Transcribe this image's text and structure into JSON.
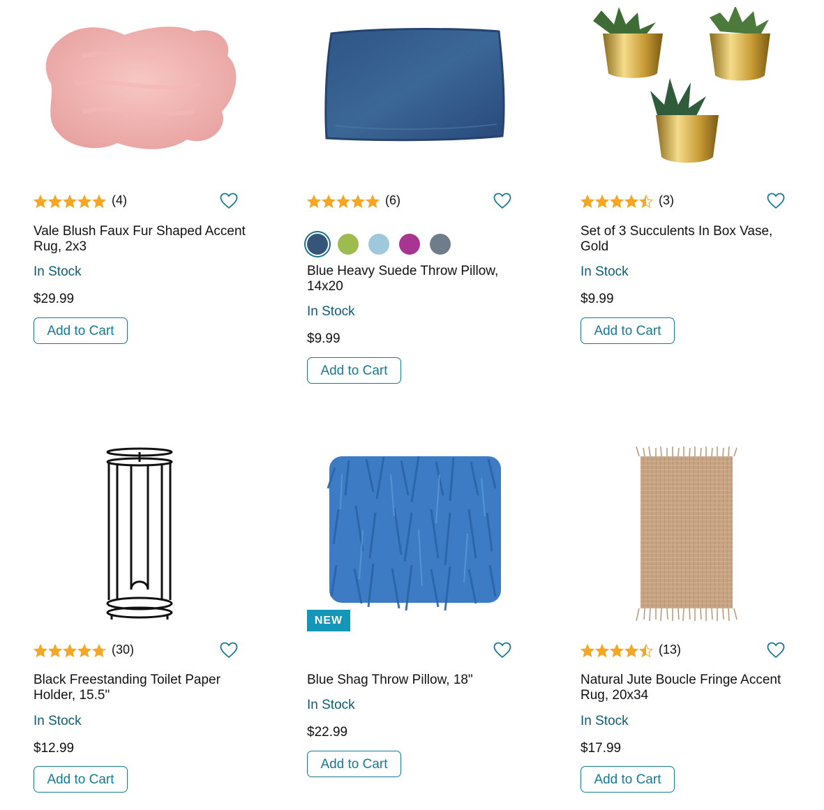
{
  "colors": {
    "accent": "#167993",
    "stock": "#0d5c7a",
    "star_fill": "#f5a623",
    "badge": "#1496b8"
  },
  "products": [
    {
      "name": "Vale Blush Faux Fur Shaped Accent Rug, 2x3",
      "rating": 5,
      "review_count": "(4)",
      "stock": "In Stock",
      "price": "$29.99",
      "cta": "Add to Cart",
      "image_icon": "pink-faux-fur-rug-image"
    },
    {
      "name": "Blue Heavy Suede Throw Pillow, 14x20",
      "rating": 5,
      "review_count": "(6)",
      "stock": "In Stock",
      "price": "$9.99",
      "cta": "Add to Cart",
      "image_icon": "blue-suede-pillow-image",
      "swatches": [
        "#35557a",
        "#9dbb4e",
        "#9fc8dc",
        "#a83592",
        "#6f7c8a"
      ]
    },
    {
      "name": "Set of 3 Succulents In Box Vase, Gold",
      "rating": 4.5,
      "review_count": "(3)",
      "stock": "In Stock",
      "price": "$9.99",
      "cta": "Add to Cart",
      "image_icon": "gold-succulent-pots-image"
    },
    {
      "name": "Black Freestanding Toilet Paper Holder, 15.5\"",
      "rating": 4.8,
      "review_count": "(30)",
      "stock": "In Stock",
      "price": "$12.99",
      "cta": "Add to Cart",
      "image_icon": "black-wire-paper-holder-image"
    },
    {
      "name": "Blue Shag Throw Pillow, 18\"",
      "badge": "NEW",
      "stock": "In Stock",
      "price": "$22.99",
      "cta": "Add to Cart",
      "image_icon": "blue-shag-pillow-image"
    },
    {
      "name": "Natural Jute Boucle Fringe Accent Rug, 20x34",
      "rating": 4.5,
      "review_count": "(13)",
      "stock": "In Stock",
      "price": "$17.99",
      "cta": "Add to Cart",
      "image_icon": "jute-fringe-rug-image"
    }
  ]
}
